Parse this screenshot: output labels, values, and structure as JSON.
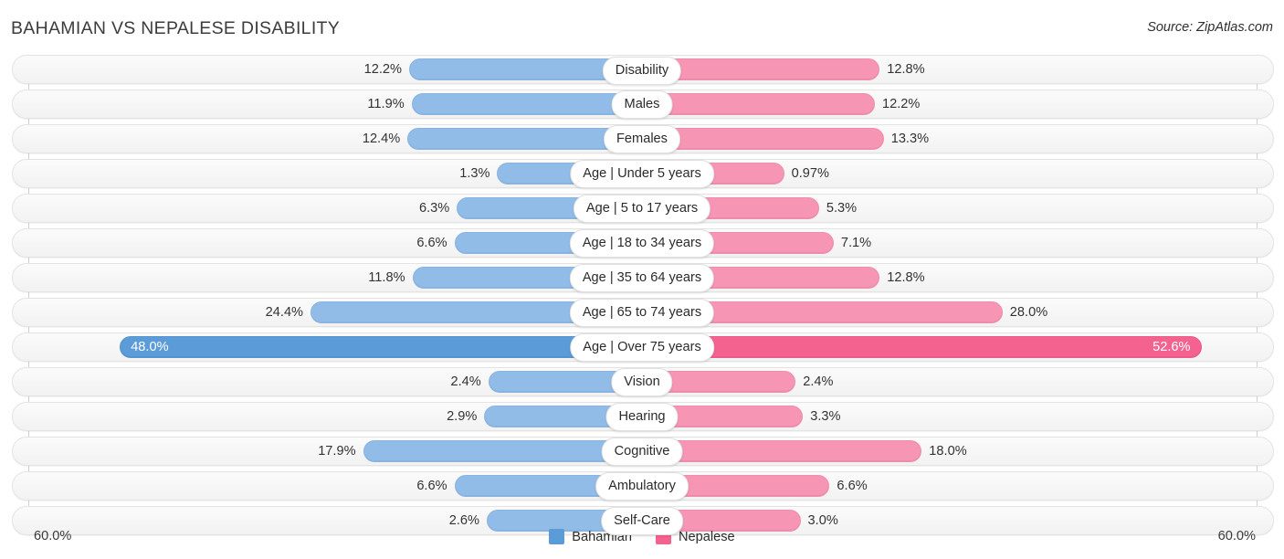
{
  "header": {
    "title": "BAHAMIAN VS NEPALESE DISABILITY",
    "source": "Source: ZipAtlas.com"
  },
  "axis": {
    "left_label": "60.0%",
    "right_label": "60.0%",
    "max": 60.0
  },
  "legend": {
    "items": [
      {
        "label": "Bahamian",
        "color": "#5b9bd8"
      },
      {
        "label": "Nepalese",
        "color": "#f4628f"
      }
    ]
  },
  "colors": {
    "left_bar": "#92bce8",
    "right_bar": "#f795b4",
    "left_bar_highlight": "#5b9bd8",
    "right_bar_highlight": "#f4628f",
    "track": "#f6f6f6",
    "gridline": "#cfcfcf"
  },
  "chart_data": {
    "type": "bar",
    "title": "BAHAMIAN VS NEPALESE DISABILITY",
    "subtitle": "Source: ZipAtlas.com",
    "orientation": "horizontal-diverging",
    "xlabel": "",
    "ylabel": "",
    "xlim": [
      60.0,
      60.0
    ],
    "grid": true,
    "legend_position": "bottom-center",
    "categories": [
      "Disability",
      "Males",
      "Females",
      "Age | Under 5 years",
      "Age | 5 to 17 years",
      "Age | 18 to 34 years",
      "Age | 35 to 64 years",
      "Age | 65 to 74 years",
      "Age | Over 75 years",
      "Vision",
      "Hearing",
      "Cognitive",
      "Ambulatory",
      "Self-Care"
    ],
    "series": [
      {
        "name": "Bahamian",
        "side": "left",
        "values": [
          12.2,
          11.9,
          12.4,
          1.3,
          6.3,
          6.6,
          11.8,
          24.4,
          48.0,
          2.4,
          2.9,
          17.9,
          6.6,
          2.6
        ],
        "labels": [
          "12.2%",
          "11.9%",
          "12.4%",
          "1.3%",
          "6.3%",
          "6.6%",
          "11.8%",
          "24.4%",
          "48.0%",
          "2.4%",
          "2.9%",
          "17.9%",
          "6.6%",
          "2.6%"
        ]
      },
      {
        "name": "Nepalese",
        "side": "right",
        "values": [
          12.8,
          12.2,
          13.3,
          0.97,
          5.3,
          7.1,
          12.8,
          28.0,
          52.6,
          2.4,
          3.3,
          18.0,
          6.6,
          3.0
        ],
        "labels": [
          "12.8%",
          "12.2%",
          "13.3%",
          "0.97%",
          "5.3%",
          "7.1%",
          "12.8%",
          "28.0%",
          "52.6%",
          "2.4%",
          "3.3%",
          "18.0%",
          "6.6%",
          "3.0%"
        ]
      }
    ],
    "highlight_row": "Age | Over 75 years"
  }
}
